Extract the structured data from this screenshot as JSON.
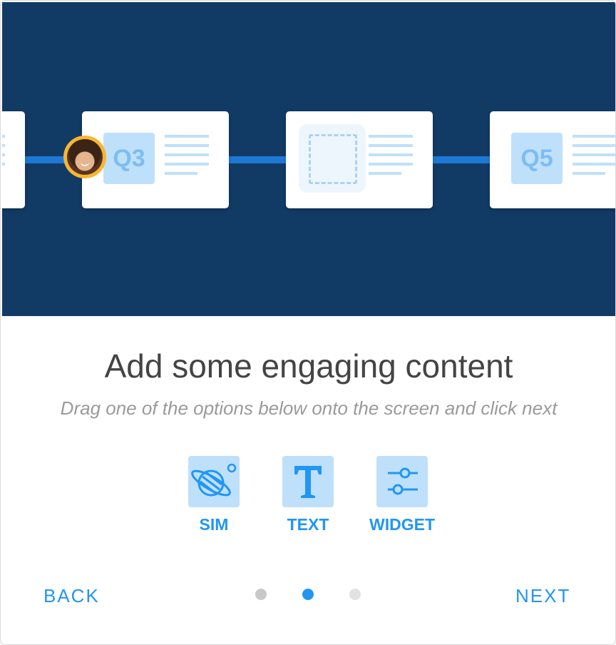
{
  "hero": {
    "slides": [
      {
        "label": ""
      },
      {
        "label": "Q3"
      },
      {
        "label": ""
      },
      {
        "label": "Q5"
      }
    ]
  },
  "title": "Add some engaging content",
  "subtitle": "Drag one of the options below onto the screen and click next",
  "options": [
    {
      "label": "SIM",
      "icon": "planet-icon"
    },
    {
      "label": "TEXT",
      "icon": "text-icon"
    },
    {
      "label": "WIDGET",
      "icon": "sliders-icon"
    }
  ],
  "footer": {
    "back_label": "BACK",
    "next_label": "NEXT",
    "pagination": {
      "total": 3,
      "active": 2
    }
  },
  "colors": {
    "hero_background": "#113b65",
    "accent": "#2196f3",
    "tile": "#bfe0fb",
    "dot_active": "#2196f3",
    "dot_inactive": "#c8c8c8"
  }
}
